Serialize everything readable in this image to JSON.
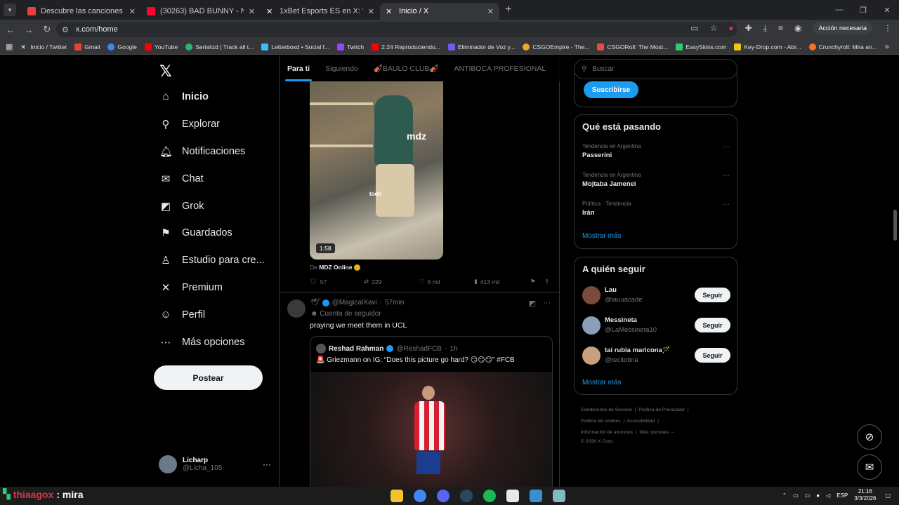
{
  "browser": {
    "tabs": [
      {
        "title": "Descubre las canciones más es",
        "color": "#e8413c"
      },
      {
        "title": "(30263) BAD BUNNY - NADIE S",
        "color": "#ff0033"
      },
      {
        "title": "1xBet Esports ES en X: \"CS:GO",
        "color": "#ffffff"
      },
      {
        "title": "Inicio / X",
        "color": "#ffffff",
        "active": true
      }
    ],
    "url": "x.com/home",
    "accion_label": "Acción necesaria",
    "bookmarks": [
      {
        "label": "Inicio / Twitter",
        "color": "#ffffff"
      },
      {
        "label": "Gmail",
        "color": "#ea4335"
      },
      {
        "label": "Google",
        "color": "#4285f4"
      },
      {
        "label": "YouTube",
        "color": "#ff0000"
      },
      {
        "label": "Serializd | Track all t...",
        "color": "#2bb673"
      },
      {
        "label": "Letterboxd • Social f...",
        "color": "#40bcf4"
      },
      {
        "label": "Twitch",
        "color": "#9146ff"
      },
      {
        "label": "2:24 Reproduciendo...",
        "color": "#ff0000"
      },
      {
        "label": "Eliminador de Voz y...",
        "color": "#6c5ce7"
      },
      {
        "label": "CSGOEmpire - The...",
        "color": "#f5a623"
      },
      {
        "label": "CSGORoll: The Most...",
        "color": "#e74c3c"
      },
      {
        "label": "EasySkins.com",
        "color": "#2ecc71"
      },
      {
        "label": "Key-Drop.com - Abr...",
        "color": "#f1c40f"
      },
      {
        "label": "Crunchyroll: Mira an...",
        "color": "#f47521"
      }
    ]
  },
  "nav": {
    "items": [
      {
        "label": "Inicio",
        "icon": "home-icon",
        "glyph": "⌂"
      },
      {
        "label": "Explorar",
        "icon": "search-icon",
        "glyph": "⚲"
      },
      {
        "label": "Notificaciones",
        "icon": "bell-icon",
        "glyph": "♫"
      },
      {
        "label": "Chat",
        "icon": "mail-icon",
        "glyph": "✉"
      },
      {
        "label": "Grok",
        "icon": "grok-icon",
        "glyph": "◩"
      },
      {
        "label": "Guardados",
        "icon": "bookmark-icon",
        "glyph": "⚑"
      },
      {
        "label": "Estudio para cre...",
        "icon": "studio-icon",
        "glyph": "♙"
      },
      {
        "label": "Premium",
        "icon": "x-icon",
        "glyph": "✕"
      },
      {
        "label": "Perfil",
        "icon": "person-icon",
        "glyph": "☺"
      },
      {
        "label": "Más opciones",
        "icon": "more-icon",
        "glyph": "⋯"
      }
    ],
    "post_label": "Postear",
    "profile": {
      "name": "Licharp",
      "handle": "@Licha_105"
    }
  },
  "feed": {
    "tabs": [
      "Para ti",
      "Siguiendo",
      "🎻BAULO CLUB🎻",
      "ANTIBOCA PROFESIONAL",
      "Ba"
    ],
    "tweet1": {
      "video_overlay_logo": "mdz",
      "video_subtitle": "todo",
      "duration": "1:58",
      "from_prefix": "De",
      "from_name": "MDZ Online",
      "replies": "57",
      "reposts": "229",
      "likes": "6 mil",
      "views": "413 mil"
    },
    "tweet2": {
      "handle": "@MagicalXavi",
      "time": "57min",
      "follower_note": "Cuenta de seguidor",
      "text": "praying we meet them in UCL",
      "quote": {
        "name": "Reshad Rahman",
        "handle": "@ReshadFCB",
        "time": "1h",
        "text": "🚨 Griezmann on IG: “Does this picture go hard? 😏😏😏” #FCB"
      }
    }
  },
  "right": {
    "search_placeholder": "Buscar",
    "subscribe_label": "Suscribirse",
    "trending": {
      "title": "Qué está pasando",
      "items": [
        {
          "context": "Tendencia en Argentina",
          "name": "Passerini"
        },
        {
          "context": "Tendencia en Argentina",
          "name": "Mojtaba Jamenei"
        },
        {
          "context": "Política · Tendencia",
          "name": "Irán"
        }
      ],
      "show_more": "Mostrar más"
    },
    "who_to_follow": {
      "title": "A quién seguir",
      "items": [
        {
          "name": "Lau",
          "handle": "@lauuacade",
          "color": "#7a4a3a"
        },
        {
          "name": "Messineta",
          "handle": "@LaMessineta10",
          "color": "#8aa0b8"
        },
        {
          "name": "tai rubia maricona🪄",
          "handle": "@tecitotina",
          "color": "#c8a080"
        }
      ],
      "follow_label": "Seguir",
      "show_more": "Mostrar más"
    },
    "footer": {
      "line1": [
        "Condiciones de Servicio",
        "Política de Privacidad"
      ],
      "line2": [
        "Política de cookies",
        "Accesibilidad"
      ],
      "line3": [
        "Información de anuncios",
        "Más opciones ···"
      ],
      "copyright": "© 2026 X Corp."
    }
  },
  "taskbar": {
    "overlay_name": "thiaagox",
    "overlay_text": ": mira",
    "lang": "ESP",
    "time": "21:16",
    "date": "3/3/2026"
  }
}
